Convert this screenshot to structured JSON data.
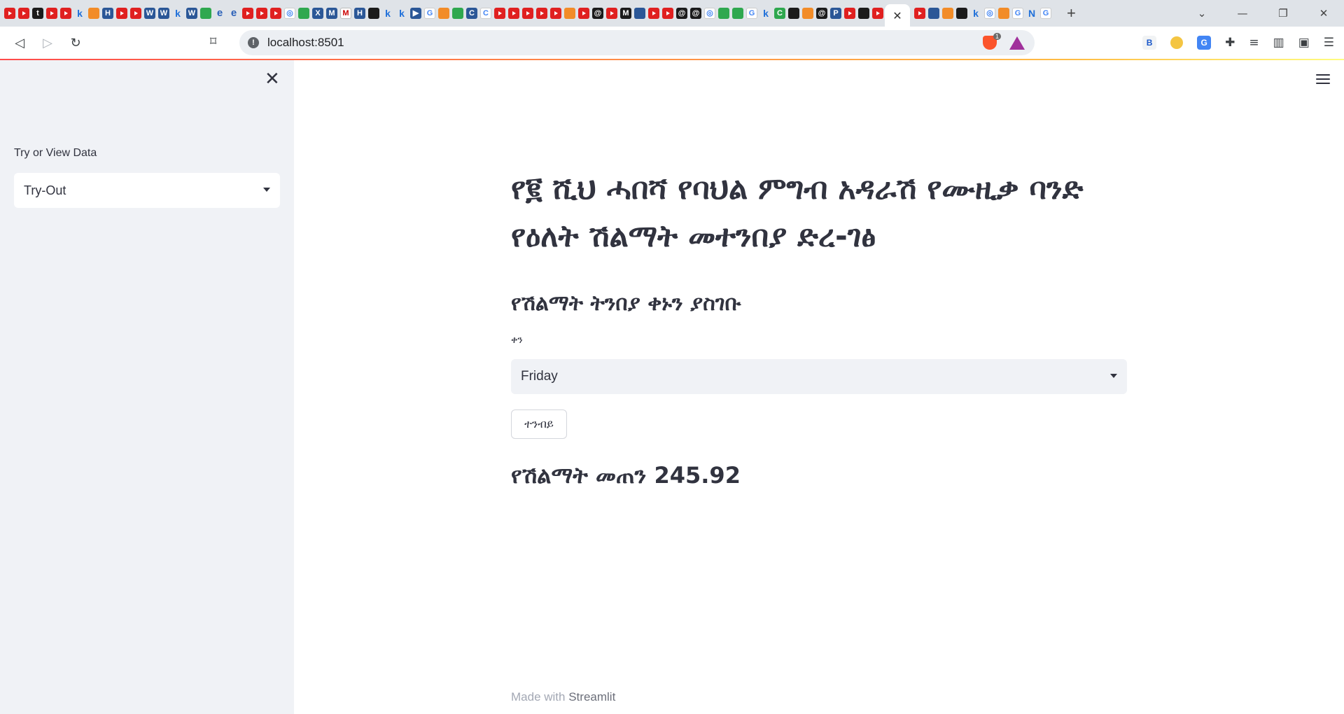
{
  "browser": {
    "address": "localhost:8501",
    "brave_badge_count": "1",
    "extension_b_label": "B",
    "active_tab_close": "✕",
    "new_tab": "+",
    "window_controls": {
      "dropdown": "⌄",
      "minimize": "—",
      "restore": "❐",
      "close": "✕"
    },
    "tab_favicons": [
      "youtube",
      "youtube",
      "tds",
      "youtube",
      "youtube",
      "k",
      "stack",
      "hc",
      "youtube",
      "youtube",
      "w",
      "w",
      "k",
      "w",
      "green-globe",
      "e",
      "e",
      "youtube",
      "youtube",
      "youtube",
      "g",
      "green",
      "x",
      "m",
      "gmail",
      "h",
      "qr",
      "k",
      "k",
      "play",
      "g",
      "stack",
      "green-a",
      "c",
      "c",
      "youtube",
      "youtube",
      "youtube",
      "youtube",
      "youtube",
      "orange",
      "youtube",
      "threads",
      "youtube",
      "m",
      "python",
      "youtube",
      "youtube",
      "threads",
      "threads",
      "g",
      "green-a",
      "green-a",
      "g",
      "k",
      "green-c",
      "globe",
      "stack",
      "threads",
      "p",
      "youtube",
      "hbo",
      "youtube"
    ],
    "tab_favicons_after_active": [
      "red",
      "blue",
      "orange",
      "github",
      "k",
      "g",
      "stack",
      "g",
      "n",
      "g"
    ]
  },
  "sidebar": {
    "close_icon": "✕",
    "select_label": "Try or View Data",
    "select_value": "Try-Out"
  },
  "main": {
    "title": "የ፪ ሺህ ሓበሻ የባህል ምግብ አዳራሽ የሙዚቃ ባንድ የዕለት ሽልማት መተንበያ ድረ-ገፅ",
    "subheader": "የሽልማት ትንበያ ቀኑን ያስገቡ",
    "day_label": "ቀን",
    "day_value": "Friday",
    "predict_button": "ተንብይ",
    "result_prefix": "የሽልማት መጠን",
    "result_value": "245.92"
  },
  "footer": {
    "made_with": "Made with",
    "brand": "Streamlit"
  },
  "colors": {
    "accent_gradient_start": "#ff4b4b",
    "accent_gradient_mid": "#ffbd45",
    "sidebar_bg": "#f0f2f6",
    "text": "#31333f"
  }
}
